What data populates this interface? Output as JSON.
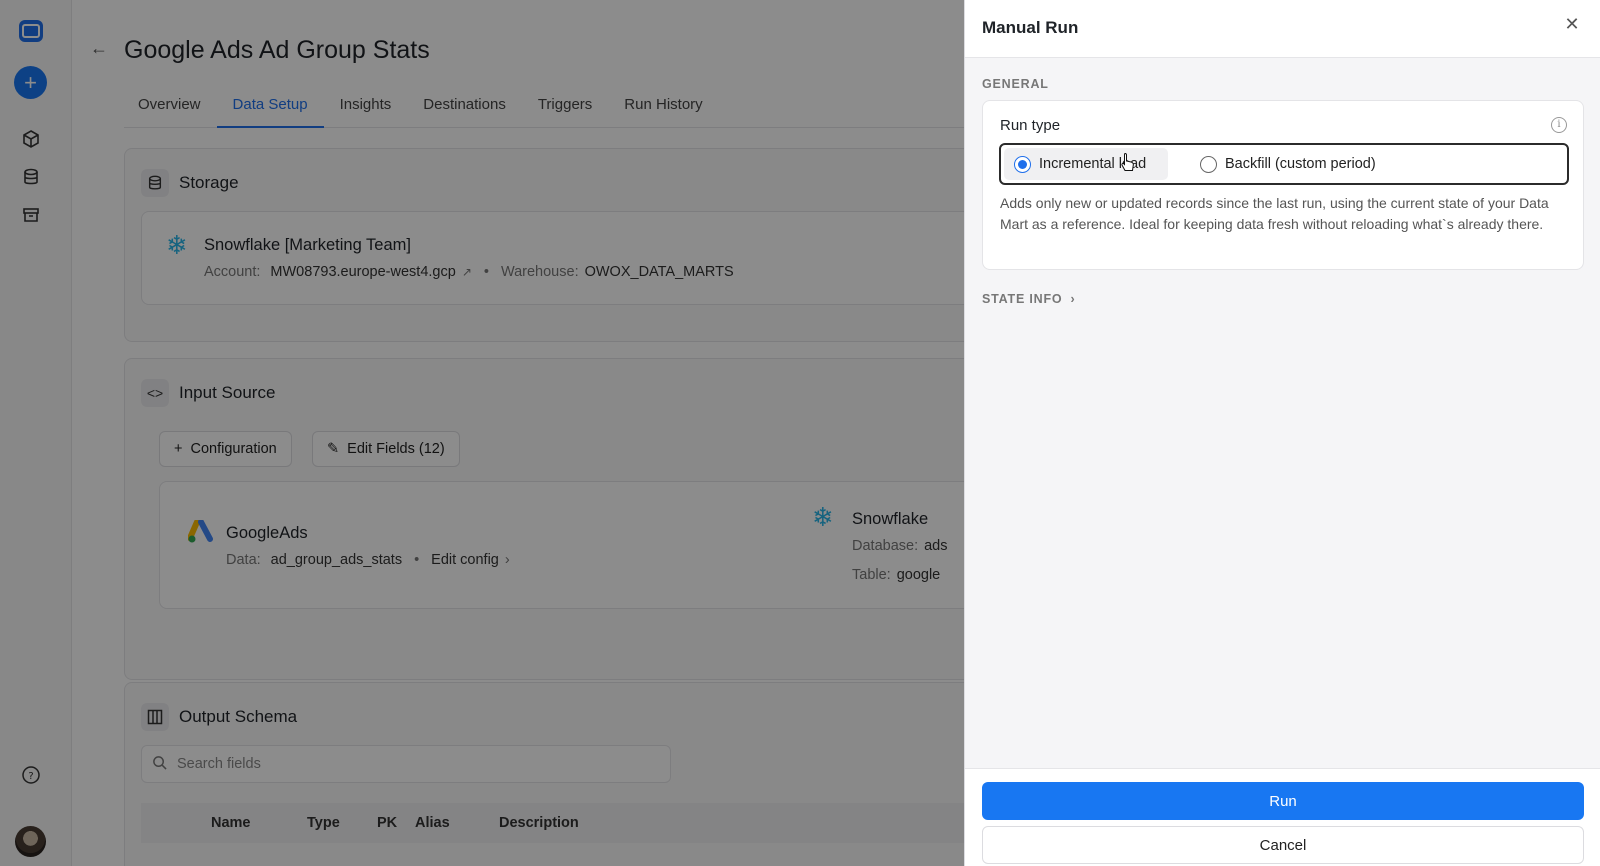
{
  "page": {
    "title": "Google Ads Ad Group Stats",
    "tabs": [
      {
        "label": "Overview"
      },
      {
        "label": "Data Setup"
      },
      {
        "label": "Insights"
      },
      {
        "label": "Destinations"
      },
      {
        "label": "Triggers"
      },
      {
        "label": "Run History"
      }
    ],
    "active_tab": "Data Setup"
  },
  "storage": {
    "heading": "Storage",
    "name": "Snowflake [Marketing Team]",
    "account_label": "Account:",
    "account_value": "MW08793.europe-west4.gcp",
    "separator": "•",
    "warehouse_label": "Warehouse:",
    "warehouse_value": "OWOX_DATA_MARTS"
  },
  "input_source": {
    "heading": "Input Source",
    "config_button": "Configuration",
    "edit_fields_button": "Edit Fields (12)",
    "source_name": "GoogleAds",
    "data_label": "Data:",
    "data_value": "ad_group_ads_stats",
    "separator": "•",
    "edit_config": "Edit config",
    "dest_name": "Snowflake",
    "database_label": "Database:",
    "database_value": "ads",
    "table_label": "Table:",
    "table_value": "google"
  },
  "output_schema": {
    "heading": "Output Schema",
    "search_placeholder": "Search fields",
    "columns": [
      "Name",
      "Type",
      "PK",
      "Alias",
      "Description"
    ]
  },
  "drawer": {
    "title": "Manual Run",
    "section_general": "GENERAL",
    "run_type_label": "Run type",
    "options": [
      {
        "label": "Incremental load",
        "selected": true
      },
      {
        "label": "Backfill (custom period)",
        "selected": false
      }
    ],
    "description": "Adds only new or updated records since the last run, using the current state of your Data Mart as a reference. Ideal for keeping data fresh without reloading what`s already there.",
    "state_info": "STATE INFO",
    "run_button": "Run",
    "cancel_button": "Cancel"
  },
  "colors": {
    "accent": "#1877f2",
    "snowflake": "#29b5e8"
  }
}
